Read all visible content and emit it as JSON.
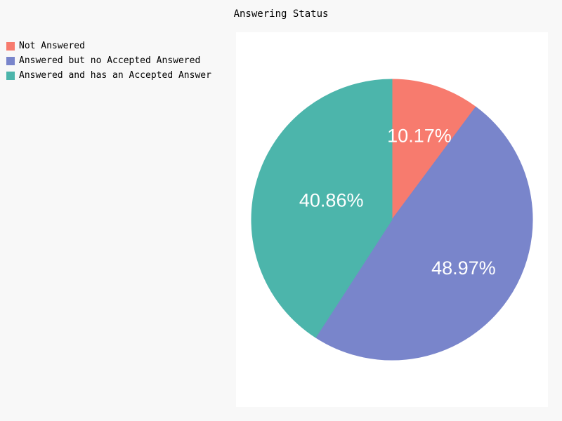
{
  "chart_data": {
    "type": "pie",
    "title": "Answering Status",
    "slices": [
      {
        "label": "Not Answered",
        "value": 10.17,
        "display": "10.17%",
        "color": "#f77b6e"
      },
      {
        "label": "Answered but no Accepted Answered",
        "value": 48.97,
        "display": "48.97%",
        "color": "#7985cb"
      },
      {
        "label": "Answered and has an Accepted Answer",
        "value": 40.86,
        "display": "40.86%",
        "color": "#4cb5ab"
      }
    ],
    "legend_position": "top-left"
  }
}
